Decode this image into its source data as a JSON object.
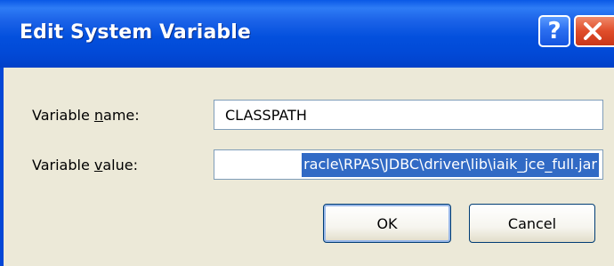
{
  "window": {
    "title": "Edit System Variable"
  },
  "titlebar_buttons": {
    "help_label": "?",
    "close_icon": "close-icon"
  },
  "form": {
    "name_label_pre": "Variable ",
    "name_label_mnemonic": "n",
    "name_label_post": "ame:",
    "value_label_pre": "Variable ",
    "value_label_mnemonic": "v",
    "value_label_post": "alue:",
    "name_value": "CLASSPATH",
    "value_value": "racle\\RPAS\\JDBC\\driver\\lib\\iaik_jce_full.jar"
  },
  "buttons": {
    "ok_label": "OK",
    "cancel_label": "Cancel"
  },
  "colors": {
    "titlebar": "#0350dd",
    "selection": "#316ac5",
    "dialog_face": "#ece9d8",
    "close_button": "#e04d2a"
  }
}
